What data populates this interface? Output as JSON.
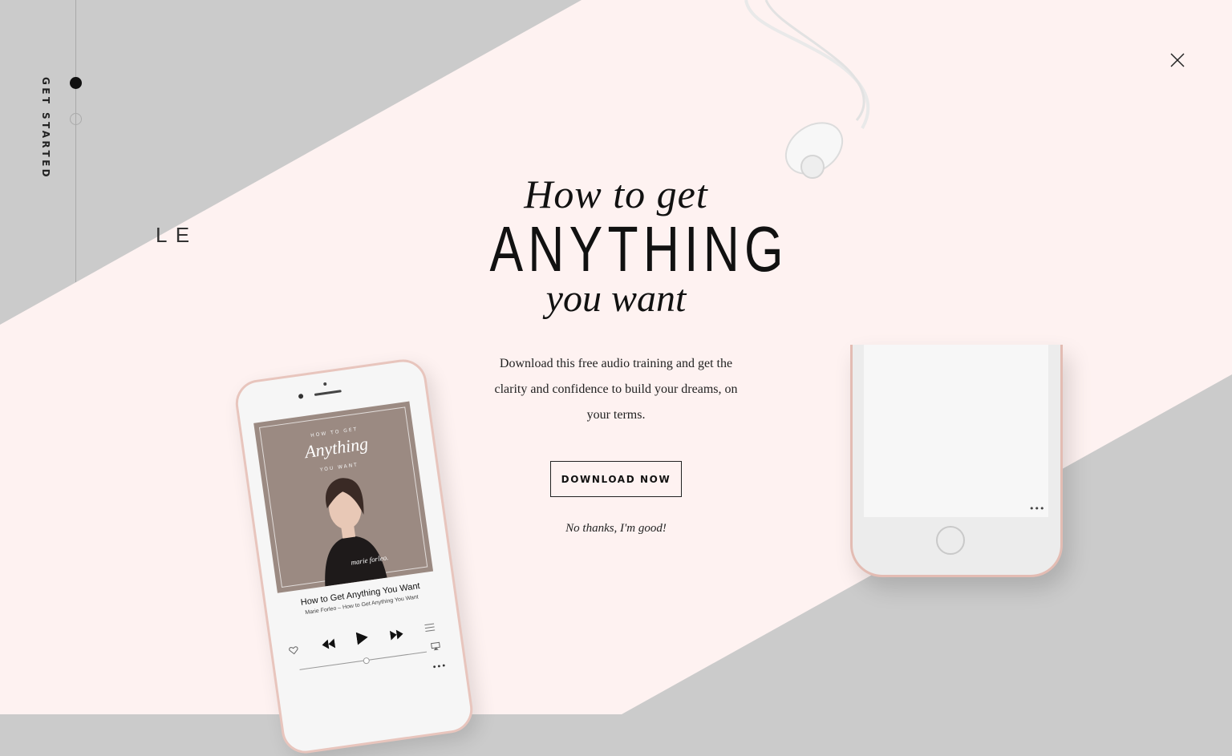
{
  "sidebar": {
    "vertical_label": "GET STARTED",
    "peek_text": "L E"
  },
  "modal": {
    "headline_line1": "How to get",
    "headline_line2": "ANYTHING",
    "headline_line3": "you want",
    "description": "Download this free audio training and get the clarity and confidence to build your dreams, on your terms.",
    "cta_label": "DOWNLOAD NOW",
    "decline_label": "No thanks, I'm good!"
  },
  "phone": {
    "album_top": "HOW TO GET",
    "album_script": "Anything",
    "album_bottom": "YOU WANT",
    "album_brand": "marie forleo.",
    "track_title": "How to Get Anything You Want",
    "track_subtitle": "Marie Forleo – How to Get Anything You Want"
  },
  "colors": {
    "modal_bg": "#fef2f1",
    "page_bg": "#cbcbcb",
    "accent_rose": "#e8c5bd",
    "text": "#111111"
  },
  "icons": [
    "close-icon",
    "heart-icon",
    "rewind-icon",
    "play-icon",
    "fast-forward-icon",
    "list-icon",
    "airplay-icon",
    "more-icon"
  ]
}
